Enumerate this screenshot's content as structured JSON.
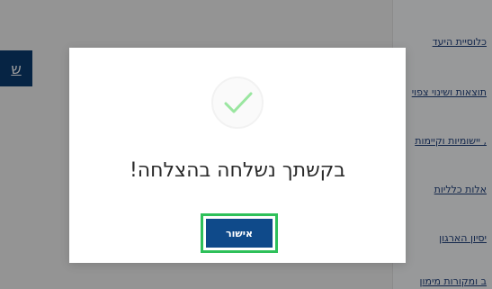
{
  "background": {
    "sidebar_links": [
      "כלוסיית היעד",
      "תוצאות ושינוי צפוי",
      ", יישומיות וקיימות",
      "אלות כלליות",
      "יסיון הארגון",
      "ב ומקורות מימון"
    ],
    "left_button_label": "ש"
  },
  "modal": {
    "icon": "check-icon",
    "message": "בקשתך נשלחה בהצלחה!",
    "confirm_label": "אישור"
  },
  "colors": {
    "primary": "#0f4a8a",
    "focus_outline": "#2ec05a",
    "check": "#9ae6a0"
  }
}
